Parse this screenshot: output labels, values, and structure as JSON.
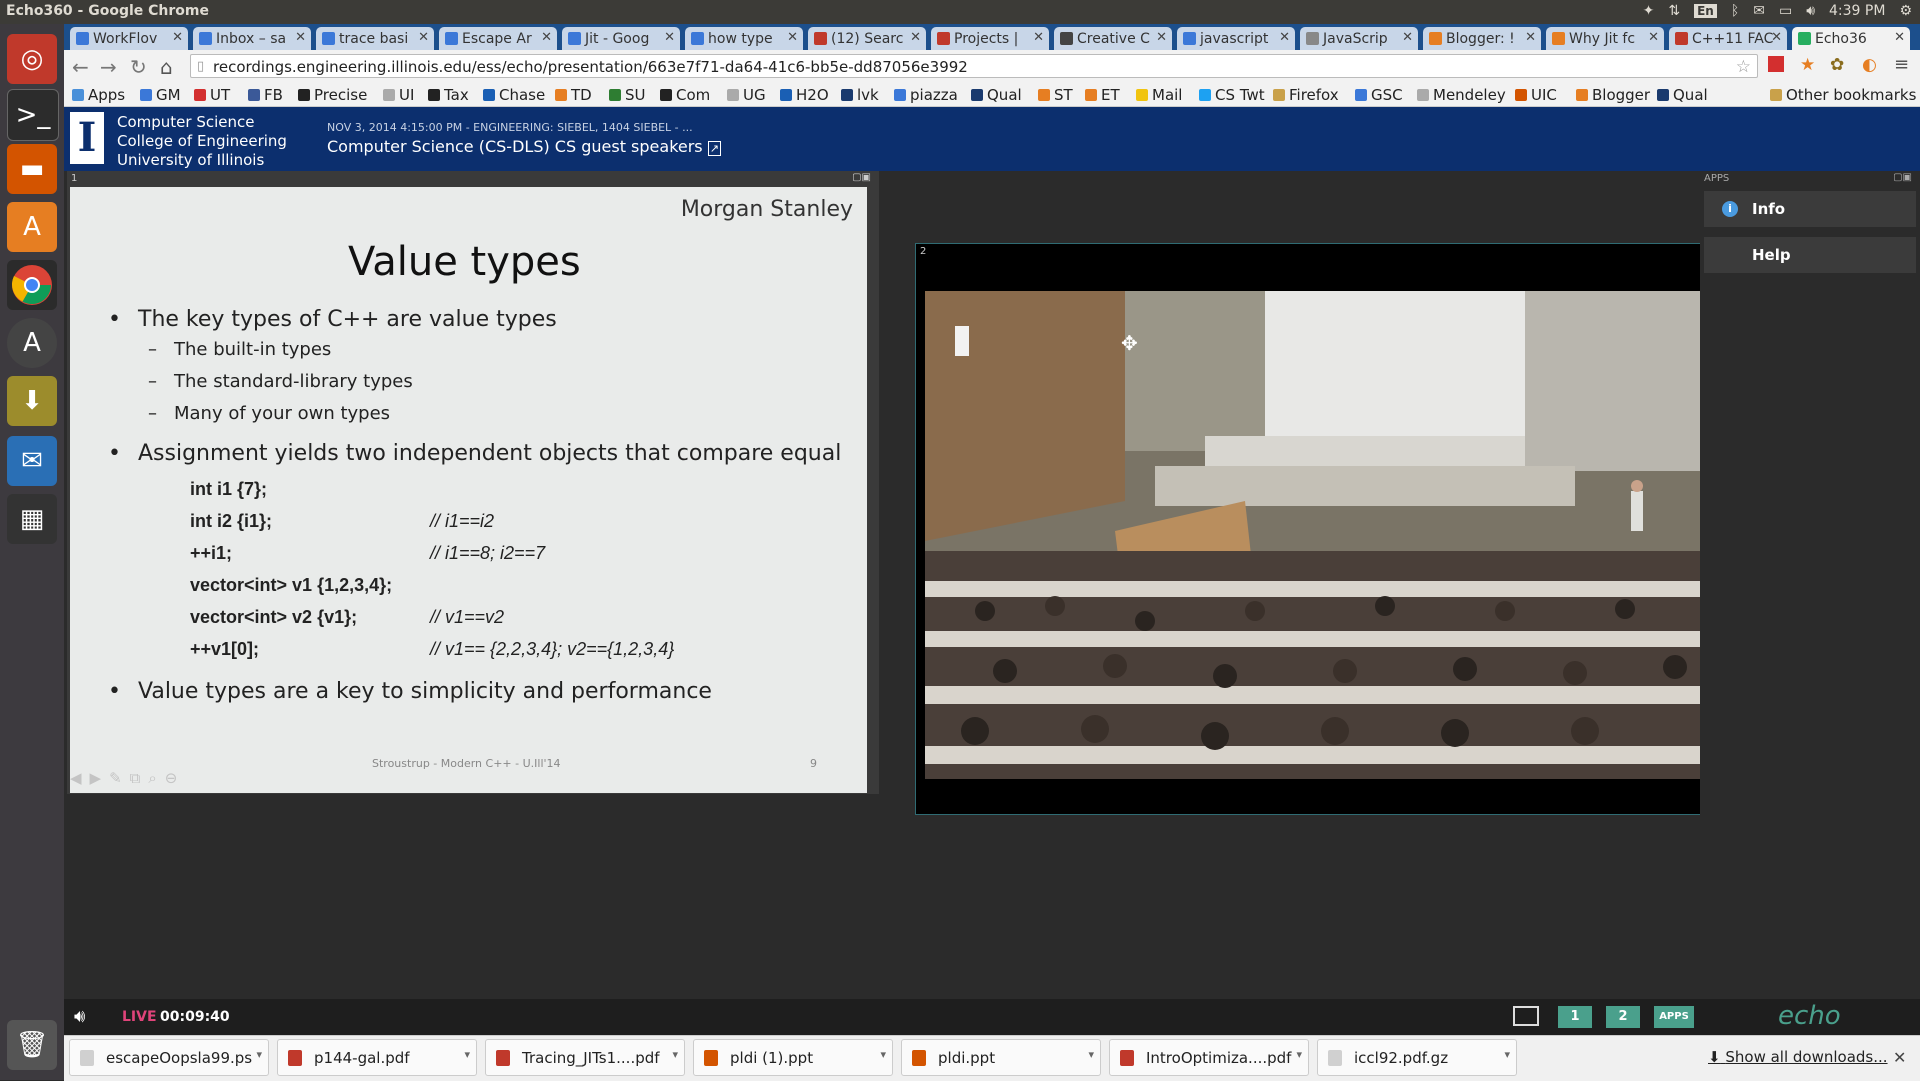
{
  "system": {
    "window_title": "Echo360 - Google Chrome",
    "clock": "4:39 PM",
    "keyboard": "En"
  },
  "tabs": [
    {
      "label": "WorkFlov",
      "color": "#3b78d8"
    },
    {
      "label": "Inbox – sa",
      "color": "#3b78d8"
    },
    {
      "label": "trace basi",
      "color": "#3b78d8"
    },
    {
      "label": "Escape Ar",
      "color": "#3b78d8"
    },
    {
      "label": "Jit - Goog",
      "color": "#3b78d8"
    },
    {
      "label": "how type",
      "color": "#3b78d8"
    },
    {
      "label": "(12) Searc",
      "color": "#c0392b"
    },
    {
      "label": "Projects |",
      "color": "#c0392b"
    },
    {
      "label": "Creative C",
      "color": "#444444"
    },
    {
      "label": "javascript",
      "color": "#3b78d8"
    },
    {
      "label": "JavaScrip",
      "color": "#888888"
    },
    {
      "label": "Blogger: !",
      "color": "#e67e22"
    },
    {
      "label": "Why Jit fc",
      "color": "#e67e22"
    },
    {
      "label": "C++11 FAC",
      "color": "#c0392b"
    },
    {
      "label": "Echo36",
      "color": "#27ae60"
    }
  ],
  "address": "recordings.engineering.illinois.edu/ess/echo/presentation/663e7f71-da64-41c6-bb5e-dd87056e3992",
  "bookmarks": [
    {
      "label": "Apps",
      "color": "#4a90d9"
    },
    {
      "label": "GM",
      "color": "#3b78d8"
    },
    {
      "label": "UT",
      "color": "#d32f2f"
    },
    {
      "label": "FB",
      "color": "#3b5998"
    },
    {
      "label": "Precise",
      "color": "#222222"
    },
    {
      "label": "UI",
      "color": "#aaaaaa"
    },
    {
      "label": "Tax",
      "color": "#222222"
    },
    {
      "label": "Chase",
      "color": "#1a5fb4"
    },
    {
      "label": "TD",
      "color": "#e67e22"
    },
    {
      "label": "SU",
      "color": "#2e7d32"
    },
    {
      "label": "Com",
      "color": "#222222"
    },
    {
      "label": "UG",
      "color": "#aaaaaa"
    },
    {
      "label": "H2O",
      "color": "#1a5fb4"
    },
    {
      "label": "lvk",
      "color": "#1a3a6e"
    },
    {
      "label": "piazza",
      "color": "#3b78d8"
    },
    {
      "label": "Qual",
      "color": "#1a3a6e"
    },
    {
      "label": "ST",
      "color": "#e67e22"
    },
    {
      "label": "ET",
      "color": "#e67e22"
    },
    {
      "label": "Mail",
      "color": "#f1c40f"
    },
    {
      "label": "CS Twt",
      "color": "#1da1f2"
    },
    {
      "label": "Firefox",
      "color": "#c9a14a"
    },
    {
      "label": "GSC",
      "color": "#3b78d8"
    },
    {
      "label": "Mendeley",
      "color": "#aaaaaa"
    },
    {
      "label": "UIC",
      "color": "#d35400"
    },
    {
      "label": "Blogger",
      "color": "#e67e22"
    },
    {
      "label": "Qual",
      "color": "#1a3a6e"
    }
  ],
  "other_bookmarks": "Other bookmarks",
  "header": {
    "org_line1": "Computer Science",
    "org_line2": "College of Engineering",
    "org_line3": "University of Illinois",
    "meta": "NOV 3, 2014 4:15:00 PM - ENGINEERING: SIEBEL, 1404 SIEBEL - ...",
    "title": "Computer Science (CS-DLS) CS guest speakers"
  },
  "panels": {
    "slide_number": "1",
    "video_number": "2",
    "apps_title": "APPS"
  },
  "slide": {
    "brand": "Morgan Stanley",
    "title": "Value types",
    "b1": "The key types of C++ are value types",
    "s1": "The built-in types",
    "s2": "The standard-library types",
    "s3": "Many of your own types",
    "b2": "Assignment yields two independent objects that compare equal",
    "code": [
      {
        "c": "int i1 {7};",
        "m": ""
      },
      {
        "c": "int i2 {i1};",
        "m": "// i1==i2"
      },
      {
        "c": "++i1;",
        "m": "// i1==8; i2==7"
      },
      {
        "c": "vector<int> v1  {1,2,3,4};",
        "m": ""
      },
      {
        "c": "vector<int> v2 {v1};",
        "m": "// v1==v2"
      },
      {
        "c": "++v1[0];",
        "m": "// v1== {2,2,3,4}; v2=={1,2,3,4}"
      }
    ],
    "b3": "Value types are a key to simplicity and performance",
    "footer": "Stroustrup - Modern C++ - U.Ill'14",
    "page": "9"
  },
  "apps": {
    "info": "Info",
    "help": "Help"
  },
  "controls": {
    "live": "LIVE",
    "time": "00:09:40",
    "btn1": "1",
    "btn2": "2",
    "apps_btn": "APPS",
    "brand": "echo"
  },
  "downloads": [
    {
      "name": "escapeOopsla99.ps",
      "color": "#d0d0d0"
    },
    {
      "name": "p144-gal.pdf",
      "color": "#c0392b"
    },
    {
      "name": "Tracing_JITs1....pdf",
      "color": "#c0392b"
    },
    {
      "name": "pldi (1).ppt",
      "color": "#d35400"
    },
    {
      "name": "pldi.ppt",
      "color": "#d35400"
    },
    {
      "name": "IntroOptimiza....pdf",
      "color": "#c0392b"
    },
    {
      "name": "iccl92.pdf.gz",
      "color": "#d0d0d0"
    }
  ],
  "show_all_downloads": "Show all downloads..."
}
